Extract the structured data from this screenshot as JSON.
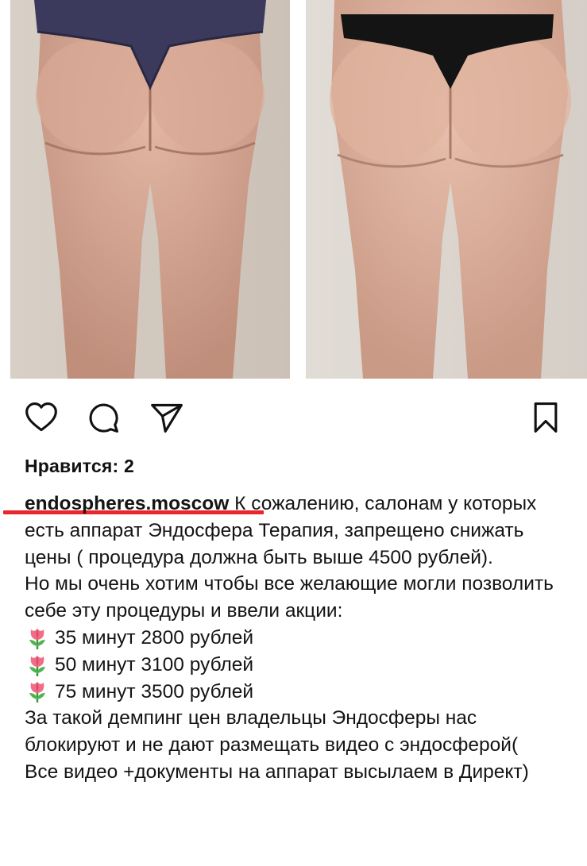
{
  "post": {
    "likes_text": "Нравится: 2",
    "username": "endospheres.moscow",
    "caption_paragraphs": [
      "К сожалению, салонам у которых есть аппарат Эндосфера Терапия, запрещено снижать цены ( процедура должна быть выше 4500 рублей).",
      "Но мы очень хотим чтобы все желающие могли позволить себе эту процедуры и ввели акции:"
    ],
    "price_lines": [
      "35 минут 2800 рублей",
      "50 минут 3100 рублей",
      "75 минут 3500 рублей"
    ],
    "closing_paragraphs": [
      "За такой демпинг цен владельцы Эндосферы нас блокируют и не дают размещать видео с эндосферой(",
      "Все видео +документы на аппарат высылаем в Директ)"
    ]
  },
  "icons": {
    "like": "heart-icon",
    "comment": "comment-icon",
    "share": "paper-plane-icon",
    "save": "bookmark-icon",
    "bullet": "tulip-emoji"
  },
  "colors": {
    "annotation_underline": "#e8262c",
    "text": "#141414"
  }
}
